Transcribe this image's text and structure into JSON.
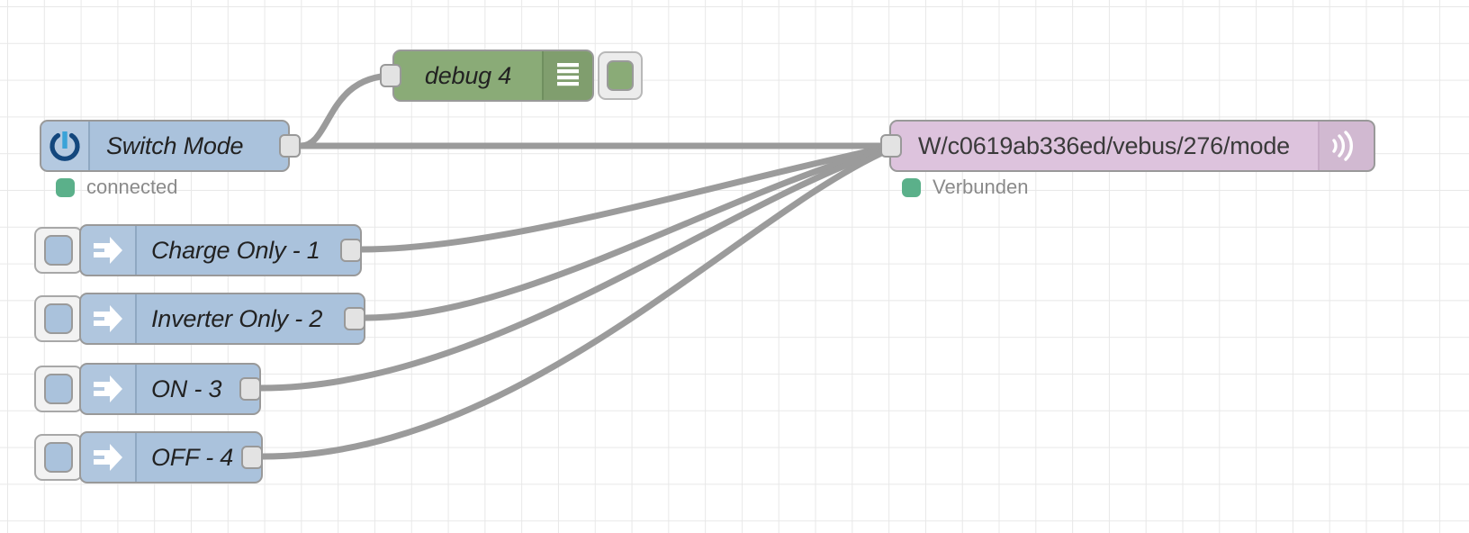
{
  "editor": {
    "type": "node-red-flow-canvas",
    "grid_spacing_px": 41,
    "grid_color": "#e8e8e8",
    "background_color": "#ffffff"
  },
  "colors": {
    "node_blue": "#aac2dc",
    "node_green": "#8aab77",
    "node_purple": "#ddc3dd",
    "node_border": "#999999",
    "wire": "#9b9b9b",
    "port_fill": "#e3e3e3",
    "status_green": "#5bb08a",
    "status_text": "#8a8a8a",
    "icon_navy": "#13477d",
    "icon_lightblue": "#3aa3d8"
  },
  "nodes": {
    "switch_mode": {
      "label": "Switch Mode",
      "icon": "power-toggle-icon",
      "color": "#aac2dc",
      "status": {
        "text": "connected",
        "color": "#5bb08a"
      }
    },
    "debug": {
      "label": "debug 4",
      "icon": "debug-list-icon",
      "color": "#8aab77",
      "button": "debug-toggle-button"
    },
    "mqtt_out": {
      "label": "W/c0619ab336ed/vebus/276/mode",
      "icon": "mqtt-broadcast-icon",
      "color": "#ddc3dd",
      "status": {
        "text": "Verbunden",
        "color": "#5bb08a"
      }
    },
    "injects": [
      {
        "label": "Charge Only - 1",
        "icon": "inject-arrow-icon",
        "button": "inject-fire-button"
      },
      {
        "label": "Inverter Only - 2",
        "icon": "inject-arrow-icon",
        "button": "inject-fire-button"
      },
      {
        "label": "ON - 3",
        "icon": "inject-arrow-icon",
        "button": "inject-fire-button"
      },
      {
        "label": "OFF - 4",
        "icon": "inject-arrow-icon",
        "button": "inject-fire-button"
      }
    ]
  },
  "connections": [
    {
      "from": "switch_mode",
      "to": "debug"
    },
    {
      "from": "switch_mode",
      "to": "mqtt_out"
    },
    {
      "from": "inject_charge_only_1",
      "to": "mqtt_out"
    },
    {
      "from": "inject_inverter_only_2",
      "to": "mqtt_out"
    },
    {
      "from": "inject_on_3",
      "to": "mqtt_out"
    },
    {
      "from": "inject_off_4",
      "to": "mqtt_out"
    }
  ]
}
